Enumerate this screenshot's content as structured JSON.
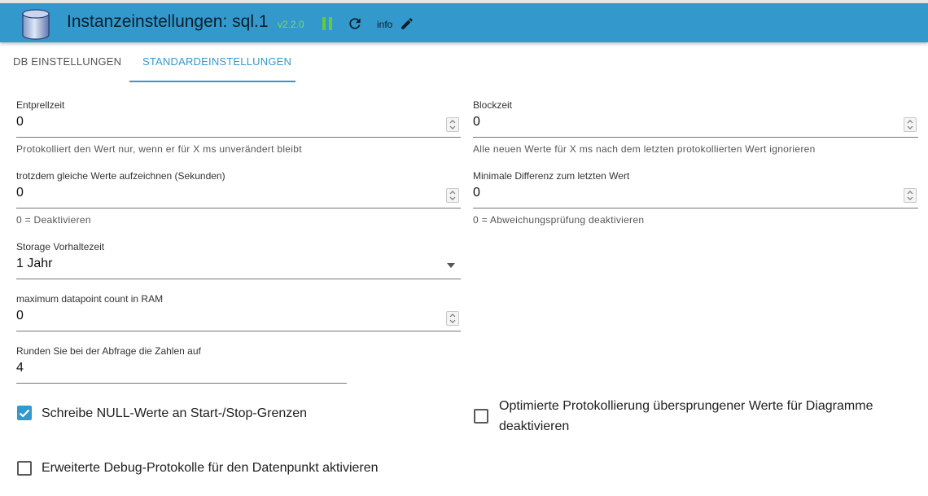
{
  "header": {
    "title": "Instanzeinstellungen: sql.1",
    "version": "v2.2.0",
    "info_label": "info",
    "icons": [
      "database-icon",
      "pause-icon",
      "reload-icon",
      "edit-icon"
    ],
    "colors": {
      "appbar": "#3399cc",
      "version": "#7ed957",
      "pause": "#66cc33"
    }
  },
  "tabs": [
    {
      "label": "DB EINSTELLUNGEN",
      "active": false
    },
    {
      "label": "STANDARDEINSTELLUNGEN",
      "active": true
    }
  ],
  "fields": {
    "entprellzeit": {
      "label": "Entprellzeit",
      "value": "0",
      "help": "Protokolliert den Wert nur, wenn er für X ms unverändert bleibt"
    },
    "blockzeit": {
      "label": "Blockzeit",
      "value": "0",
      "help": "Alle neuen Werte für X ms nach dem letzten protokollierten Wert ignorieren"
    },
    "gleiche_werte": {
      "label": "trotzdem gleiche Werte aufzeichnen (Sekunden)",
      "value": "0",
      "help": "0 = Deaktivieren"
    },
    "min_differenz": {
      "label": "Minimale Differenz zum letzten Wert",
      "value": "0",
      "help": "0 = Abweichungsprüfung deaktivieren"
    },
    "storage": {
      "label": "Storage Vorhaltezeit",
      "value": "1 Jahr"
    },
    "max_datapoints": {
      "label": "maximum datapoint count in RAM",
      "value": "0"
    },
    "runden": {
      "label": "Runden Sie bei der Abfrage die Zahlen auf",
      "value": "4"
    }
  },
  "checkboxes": {
    "null_werte": {
      "label": "Schreibe NULL-Werte an Start-/Stop-Grenzen",
      "checked": true
    },
    "optimierte": {
      "label": "Optimierte Protokollierung übersprungener Werte für Diagramme deaktivieren",
      "checked": false
    },
    "debug": {
      "label": "Erweiterte Debug-Protokolle für den Datenpunkt aktivieren",
      "checked": false
    }
  }
}
